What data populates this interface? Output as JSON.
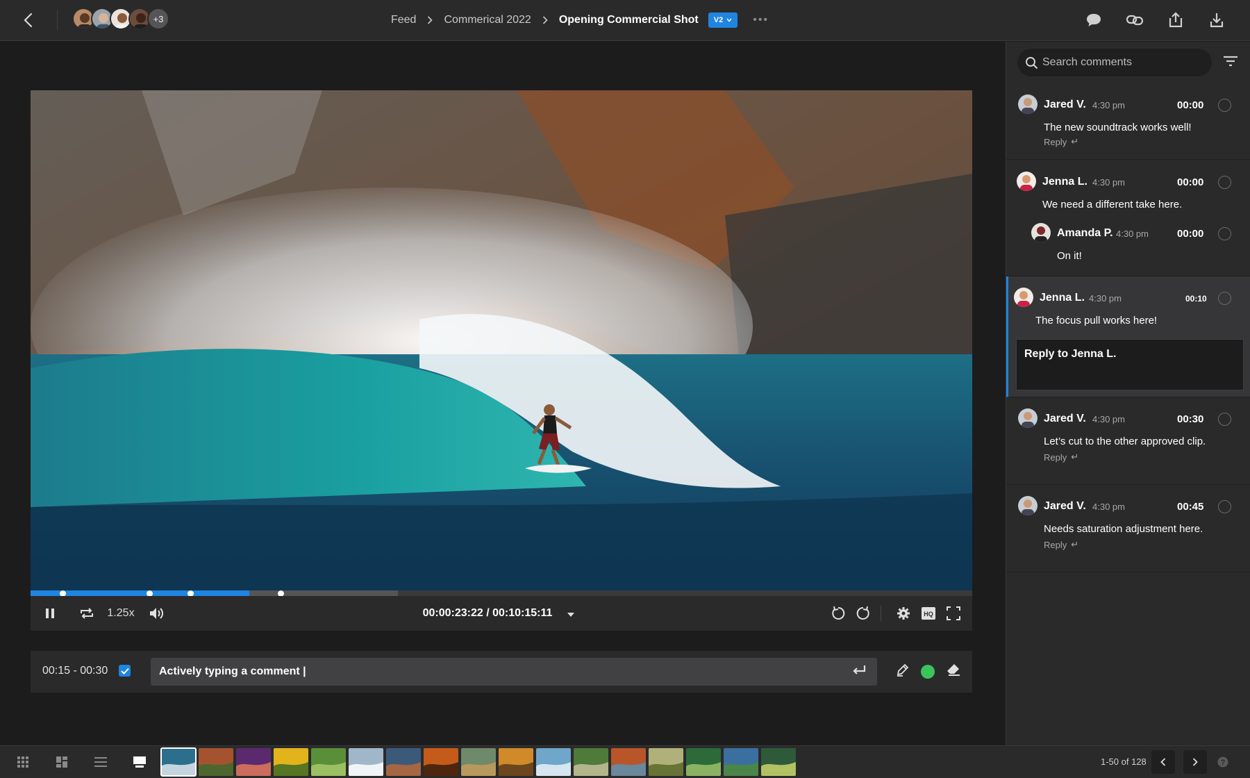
{
  "topbar": {
    "avatars_more": "+3",
    "breadcrumb": [
      "Feed",
      "Commerical 2022"
    ],
    "current_title": "Opening Commercial Shot",
    "version": "V2"
  },
  "player": {
    "speed": "1.25x",
    "timecode": "00:00:23:22 / 00:10:15:11",
    "progress_played": 0.232,
    "progress_buffered": 0.39
  },
  "comment_bar": {
    "range": "00:15 - 00:30",
    "range_checked": true,
    "input_value": "Actively typing a comment |",
    "draw_color": "#3cc35c"
  },
  "panel": {
    "search_placeholder": "Search comments",
    "reply_placeholder": "Reply to Jenna L.",
    "comments": [
      {
        "author": "Jared V.",
        "time": "4:30 pm",
        "stamp": "00:00",
        "text": "The new soundtrack works well!",
        "reply": "Reply"
      },
      {
        "author": "Jenna L.",
        "time": "4:30 pm",
        "stamp": "00:00",
        "text": "We need a different take here."
      },
      {
        "author": "Amanda P.",
        "time": "4:30 pm",
        "stamp": "00:00",
        "text": "On it!"
      },
      {
        "author": "Jenna L.",
        "time": "4:30 pm",
        "stamp": "00:10",
        "text": "The focus pull works here!"
      },
      {
        "author": "Jared V.",
        "time": "4:30 pm",
        "stamp": "00:30",
        "text": "Let’s cut to the other approved clip.",
        "reply": "Reply"
      },
      {
        "author": "Jared V.",
        "time": "4:30 pm",
        "stamp": "00:45",
        "text": "Needs saturation adjustment here.",
        "reply": "Reply"
      }
    ]
  },
  "bottom": {
    "pager": "1-50 of 128"
  },
  "colors": {
    "accent": "#1f85e0",
    "background": "#1c1c1d",
    "panel": "#2a2a2b"
  }
}
